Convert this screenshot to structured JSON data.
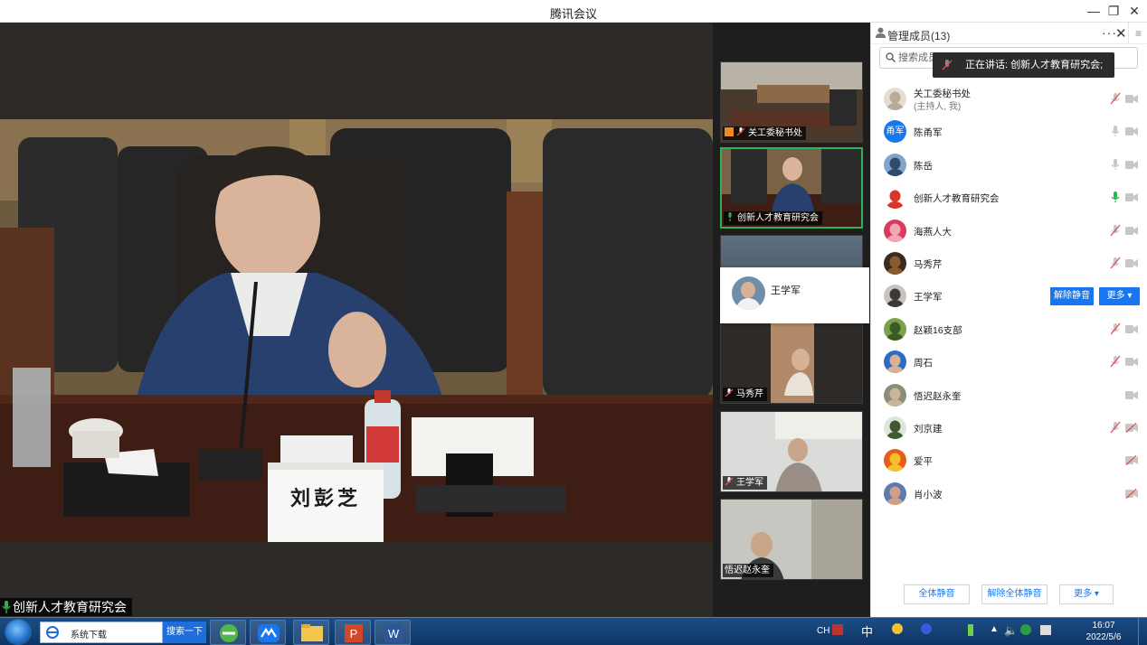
{
  "window": {
    "title": "腾讯会议"
  },
  "main_video": {
    "speaker_label": "创新人才教育研究会",
    "name_plate": "刘彭芝"
  },
  "thumbnails": [
    {
      "name": "关工委秘书处",
      "status": "host-muted"
    },
    {
      "name": "创新人才教育研究会",
      "status": "speaking"
    },
    {
      "name": "",
      "status": "blurred"
    },
    {
      "name": "马秀芹",
      "status": "muted"
    },
    {
      "name": "王学军",
      "status": "muted"
    },
    {
      "name": "悟迟赵永奎",
      "status": "none"
    }
  ],
  "hover_card": {
    "name": "王学军"
  },
  "panel": {
    "title": "管理成员(13)",
    "search_placeholder": "搜索成员",
    "speaking_tip": "正在讲话: 创新人才教育研究会;",
    "members": [
      {
        "name": "关工委秘书处",
        "sub": "(主持人, 我)",
        "mic": "muted",
        "cam": "on",
        "avatar": "photo-light"
      },
      {
        "name": "陈甬军",
        "avatar_text": "甬军",
        "mic": "on",
        "cam": "on"
      },
      {
        "name": "陈岳",
        "mic": "on",
        "cam": "on",
        "avatar": "photo-sky"
      },
      {
        "name": "创新人才教育研究会",
        "mic": "speaking",
        "cam": "on",
        "avatar": "photo-logo"
      },
      {
        "name": "海燕人大",
        "mic": "muted",
        "cam": "on",
        "avatar": "photo-pink"
      },
      {
        "name": "马秀芹",
        "mic": "muted",
        "cam": "on",
        "avatar": "photo-dark"
      },
      {
        "name": "王学军",
        "mic": "none",
        "cam": "none",
        "avatar": "photo-man",
        "actions": [
          "解除静音",
          "更多"
        ]
      },
      {
        "name": "赵颖16支部",
        "mic": "muted",
        "cam": "on",
        "avatar": "photo-green"
      },
      {
        "name": "周石",
        "mic": "muted",
        "cam": "on",
        "avatar": "photo-blue"
      },
      {
        "name": "悟迟赵永奎",
        "mic": "none",
        "cam": "on",
        "avatar": "photo-grey"
      },
      {
        "name": "刘京建",
        "mic": "muted",
        "cam": "off",
        "avatar": "photo-tree"
      },
      {
        "name": "爱平",
        "mic": "none",
        "cam": "off",
        "avatar": "photo-flower"
      },
      {
        "name": "肖小波",
        "mic": "none",
        "cam": "off",
        "avatar": "photo-person"
      }
    ],
    "footer": {
      "mute_all": "全体静音",
      "unmute_all": "解除全体静音",
      "more": "更多"
    }
  },
  "taskbar": {
    "search_value": "系统下载",
    "search_button": "搜索一下",
    "tray_text": "CH",
    "ime": "中",
    "time": "16:07",
    "date": "2022/5/6"
  },
  "colors": {
    "accent": "#1677f0",
    "speaking": "#2fb25a",
    "muted": "#e64a4a"
  }
}
